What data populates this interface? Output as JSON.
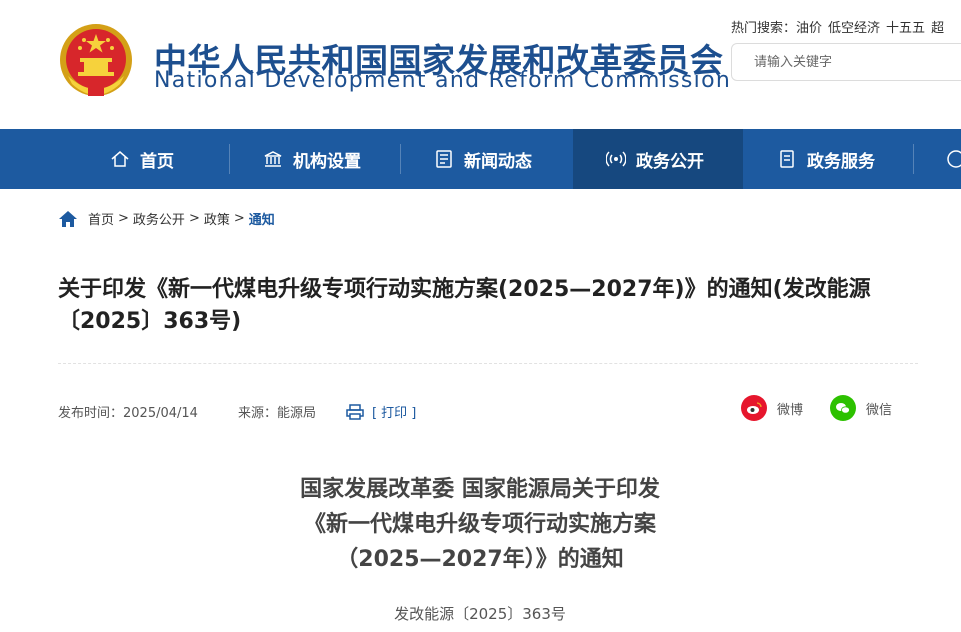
{
  "site": {
    "title_cn": "中华人民共和国国家发展和改革委员会",
    "title_en": "National Development and Reform Commission"
  },
  "hot_search": {
    "label": "热门搜索：",
    "items": [
      "油价",
      "低空经济",
      "十五五",
      "超"
    ]
  },
  "search": {
    "placeholder": "请输入关键字"
  },
  "nav": {
    "items": [
      {
        "label": "首页",
        "icon": "home-icon"
      },
      {
        "label": "机构设置",
        "icon": "institution-icon"
      },
      {
        "label": "新闻动态",
        "icon": "news-icon"
      },
      {
        "label": "政务公开",
        "icon": "broadcast-icon",
        "active": true
      },
      {
        "label": "政务服务",
        "icon": "document-icon"
      }
    ]
  },
  "breadcrumb": {
    "items": [
      "首页",
      "政务公开",
      "政策",
      "通知"
    ],
    "separator": ">"
  },
  "article": {
    "title": "关于印发《新一代煤电升级专项行动实施方案(2025—2027年)》的通知(发改能源〔2025〕363号)",
    "publish_time": "发布时间：2025/04/14",
    "source": "来源：能源局",
    "print_label": "[ 打印 ]",
    "doc_title_lines": [
      "国家发展改革委 国家能源局关于印发",
      "《新一代煤电升级专项行动实施方案",
      "（2025—2027年）》的通知"
    ],
    "doc_number": "发改能源〔2025〕363号"
  },
  "share": {
    "weibo_label": "微博",
    "wechat_label": "微信"
  },
  "colors": {
    "brand_blue": "#1d5aa0",
    "nav_active": "#16487f",
    "weibo_red": "#e6162d",
    "wechat_green": "#2dc100"
  }
}
